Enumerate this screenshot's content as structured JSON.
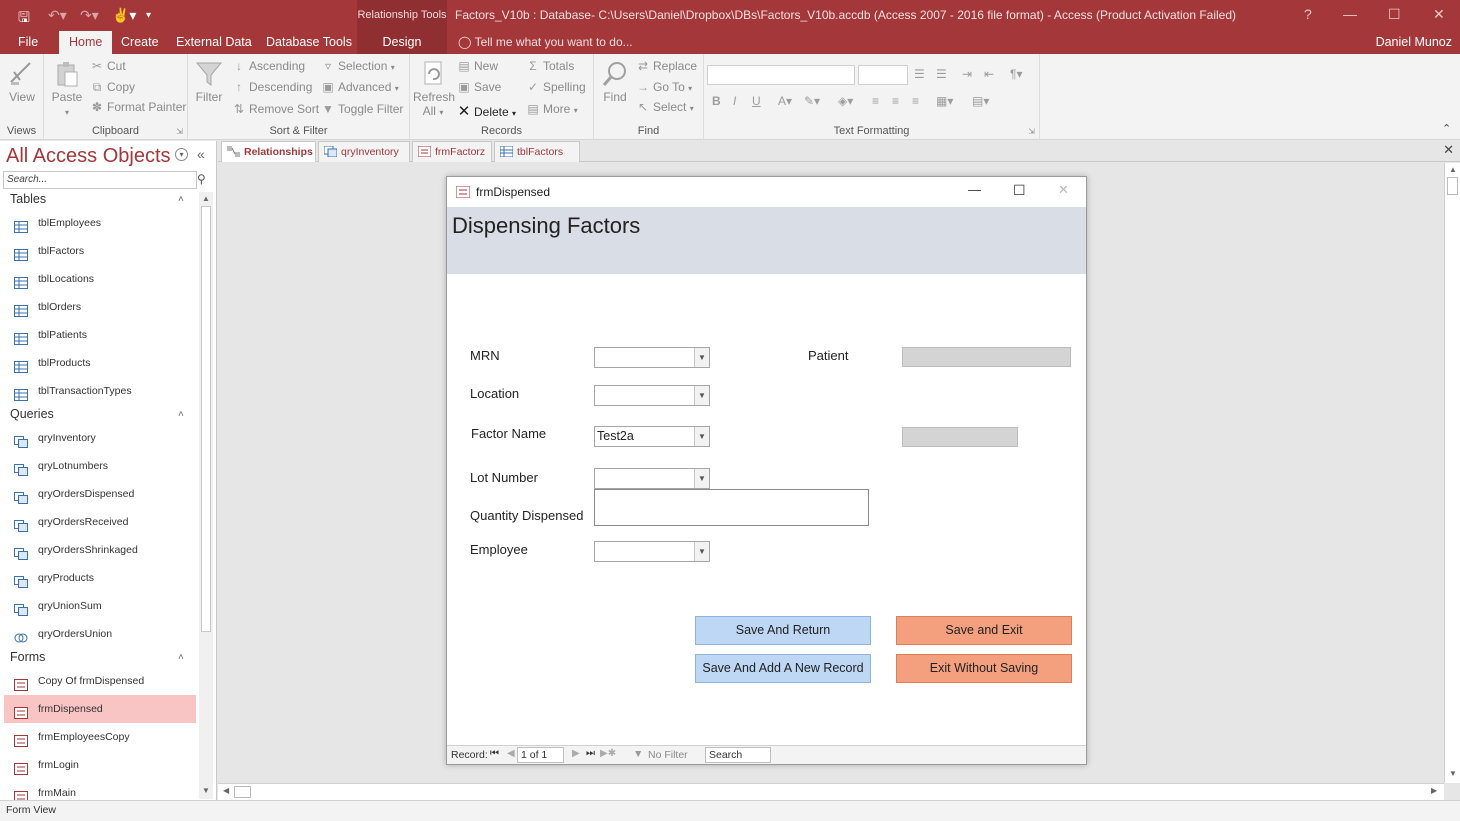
{
  "titlebar": {
    "context_label": "Relationship Tools",
    "title": "Factors_V10b : Database- C:\\Users\\Daniel\\Dropbox\\DBs\\Factors_V10b.accdb (Access 2007 - 2016 file format) - Access (Product Activation Failed)",
    "help": "?"
  },
  "ribbon_tabs": [
    "File",
    "Home",
    "Create",
    "External Data",
    "Database Tools",
    "Design"
  ],
  "tell_me": "Tell me what you want to do...",
  "user": "Daniel Munoz",
  "ribbon": {
    "views": {
      "view": "View",
      "label": "Views"
    },
    "clipboard": {
      "paste": "Paste",
      "cut": "Cut",
      "copy": "Copy",
      "format_painter": "Format Painter",
      "label": "Clipboard"
    },
    "sort_filter": {
      "filter": "Filter",
      "ascending": "Ascending",
      "descending": "Descending",
      "remove_sort": "Remove Sort",
      "selection": "Selection",
      "advanced": "Advanced",
      "toggle_filter": "Toggle Filter",
      "label": "Sort & Filter"
    },
    "records": {
      "refresh": "Refresh",
      "refresh_all": "All",
      "new": "New",
      "save": "Save",
      "delete": "Delete",
      "totals": "Totals",
      "spelling": "Spelling",
      "more": "More",
      "label": "Records"
    },
    "find": {
      "find": "Find",
      "replace": "Replace",
      "goto": "Go To",
      "select": "Select",
      "label": "Find"
    },
    "text_formatting": {
      "label": "Text Formatting"
    }
  },
  "nav": {
    "title": "All Access Objects",
    "search_placeholder": "Search...",
    "sections": [
      {
        "name": "Tables",
        "items": [
          "tblEmployees",
          "tblFactors",
          "tblLocations",
          "tblOrders",
          "tblPatients",
          "tblProducts",
          "tblTransactionTypes"
        ]
      },
      {
        "name": "Queries",
        "items": [
          "qryInventory",
          "qryLotnumbers",
          "qryOrdersDispensed",
          "qryOrdersReceived",
          "qryOrdersShrinkaged",
          "qryProducts",
          "qryUnionSum",
          "qryOrdersUnion"
        ]
      },
      {
        "name": "Forms",
        "items": [
          "Copy Of frmDispensed",
          "frmDispensed",
          "frmEmployeesCopy",
          "frmLogin",
          "frmMain"
        ]
      }
    ],
    "selected": "frmDispensed"
  },
  "doc_tabs": [
    "Relationships",
    "qryInventory",
    "frmFactorz",
    "tblFactors"
  ],
  "form": {
    "window_title": "frmDispensed",
    "heading": "Dispensing Factors",
    "labels": {
      "mrn": "MRN",
      "patient": "Patient",
      "location": "Location",
      "factor_name": "Factor Name",
      "lot_number": "Lot Number",
      "quantity": "Quantity Dispensed",
      "employee": "Employee"
    },
    "values": {
      "mrn": "",
      "location": "",
      "factor_name": "Test2a",
      "lot_number": "",
      "quantity": "",
      "employee": ""
    },
    "buttons": {
      "save_return": "Save And Return",
      "save_exit": "Save and Exit",
      "save_add": "Save And Add A New Record",
      "exit_nosave": "Exit Without Saving"
    },
    "record_nav": {
      "label": "Record:",
      "position": "1 of 1",
      "filter": "No Filter",
      "search": "Search"
    }
  },
  "status": "Form View"
}
